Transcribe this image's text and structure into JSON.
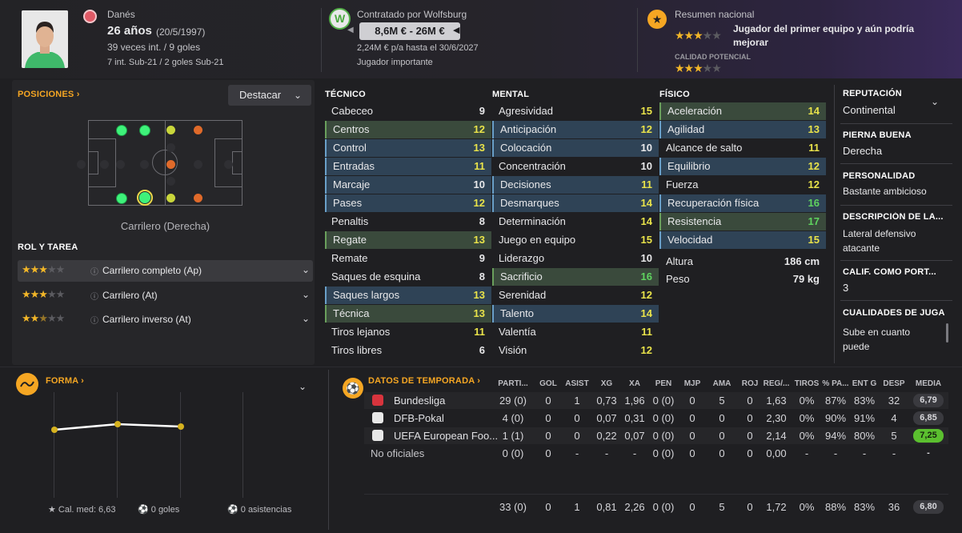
{
  "header": {
    "nationality": "Danés",
    "age": "26 años",
    "birth": "(20/5/1997)",
    "caps": "39 veces int. / 9 goles",
    "youth": "7 int. Sub-21 / 2 goles Sub-21",
    "contract_title": "Contratado por Wolfsburg",
    "value": "8,6M € - 26M €",
    "wage": "2,24M € p/a hasta el 30/6/2027",
    "squad_status": "Jugador importante",
    "national_summary": "Resumen nacional",
    "national_desc": "Jugador del primer equipo y aún podría mejorar",
    "potential_label": "CALIDAD POTENCIAL"
  },
  "positions": {
    "title": "POSICIONES",
    "highlight_btn": "Destacar",
    "selected_role": "Carrilero (Derecha)",
    "role_title": "ROL Y TAREA",
    "roles": [
      {
        "name": "Carrilero completo (Ap)"
      },
      {
        "name": "Carrilero (At)"
      },
      {
        "name": "Carrilero inverso (At)"
      }
    ]
  },
  "attributes": {
    "tech_title": "TÉCNICO",
    "mental_title": "MENTAL",
    "phys_title": "FÍSICO",
    "technical": [
      {
        "n": "Cabeceo",
        "v": "9"
      },
      {
        "n": "Centros",
        "v": "12"
      },
      {
        "n": "Control",
        "v": "13"
      },
      {
        "n": "Entradas",
        "v": "11"
      },
      {
        "n": "Marcaje",
        "v": "10"
      },
      {
        "n": "Pases",
        "v": "12"
      },
      {
        "n": "Penaltis",
        "v": "8"
      },
      {
        "n": "Regate",
        "v": "13"
      },
      {
        "n": "Remate",
        "v": "9"
      },
      {
        "n": "Saques de esquina",
        "v": "8"
      },
      {
        "n": "Saques largos",
        "v": "13"
      },
      {
        "n": "Técnica",
        "v": "13"
      },
      {
        "n": "Tiros lejanos",
        "v": "11"
      },
      {
        "n": "Tiros libres",
        "v": "6"
      }
    ],
    "mental": [
      {
        "n": "Agresividad",
        "v": "15"
      },
      {
        "n": "Anticipación",
        "v": "12"
      },
      {
        "n": "Colocación",
        "v": "10"
      },
      {
        "n": "Concentración",
        "v": "10"
      },
      {
        "n": "Decisiones",
        "v": "11"
      },
      {
        "n": "Desmarques",
        "v": "14"
      },
      {
        "n": "Determinación",
        "v": "14"
      },
      {
        "n": "Juego en equipo",
        "v": "15"
      },
      {
        "n": "Liderazgo",
        "v": "10"
      },
      {
        "n": "Sacrificio",
        "v": "16"
      },
      {
        "n": "Serenidad",
        "v": "12"
      },
      {
        "n": "Talento",
        "v": "14"
      },
      {
        "n": "Valentía",
        "v": "11"
      },
      {
        "n": "Visión",
        "v": "12"
      }
    ],
    "physical": [
      {
        "n": "Aceleración",
        "v": "14"
      },
      {
        "n": "Agilidad",
        "v": "13"
      },
      {
        "n": "Alcance de salto",
        "v": "11"
      },
      {
        "n": "Equilibrio",
        "v": "12"
      },
      {
        "n": "Fuerza",
        "v": "12"
      },
      {
        "n": "Recuperación física",
        "v": "16"
      },
      {
        "n": "Resistencia",
        "v": "17"
      },
      {
        "n": "Velocidad",
        "v": "15"
      }
    ],
    "height_label": "Altura",
    "height": "186 cm",
    "weight_label": "Peso",
    "weight": "79 kg"
  },
  "info": {
    "rep_label": "REPUTACIÓN",
    "rep": "Continental",
    "foot_label": "PIERNA BUENA",
    "foot": "Derecha",
    "pers_label": "PERSONALIDAD",
    "pers": "Bastante ambicioso",
    "desc_label": "DESCRIPCIÓN DE LA...",
    "desc": "Lateral defensivo atacante",
    "gk_label": "CALIF. COMO PORT...",
    "gk": "3",
    "qual_label": "CUALIDADES DE JUGA",
    "qual": "Sube en cuanto puede"
  },
  "form": {
    "title": "FORMA",
    "avg": "Cal. med: 6,63",
    "goals": "0 goles",
    "assists": "0 asistencias"
  },
  "season": {
    "title": "DATOS DE TEMPORADA",
    "headers": [
      "PARTI...",
      "GOL",
      "ASIST",
      "XG",
      "XA",
      "PEN",
      "MJP",
      "AMA",
      "ROJ",
      "REG/...",
      "TIROS",
      "% PA...",
      "ENT G",
      "DESP",
      "MEDIA"
    ],
    "rows": [
      {
        "comp": "Bundesliga",
        "vals": [
          "29 (0)",
          "0",
          "1",
          "0,73",
          "1,96",
          "0 (0)",
          "0",
          "5",
          "0",
          "1,63",
          "0%",
          "87%",
          "83%",
          "32"
        ],
        "media": "6,79"
      },
      {
        "comp": "DFB-Pokal",
        "vals": [
          "4 (0)",
          "0",
          "0",
          "0,07",
          "0,31",
          "0 (0)",
          "0",
          "0",
          "0",
          "2,30",
          "0%",
          "90%",
          "91%",
          "4"
        ],
        "media": "6,85"
      },
      {
        "comp": "UEFA European Foo...",
        "vals": [
          "1 (1)",
          "0",
          "0",
          "0,22",
          "0,07",
          "0 (0)",
          "0",
          "0",
          "0",
          "2,14",
          "0%",
          "94%",
          "80%",
          "5"
        ],
        "media": "7,25"
      },
      {
        "comp": "No oficiales",
        "vals": [
          "0 (0)",
          "0",
          "-",
          "-",
          "-",
          "0 (0)",
          "0",
          "0",
          "0",
          "0,00",
          "-",
          "-",
          "-",
          "-"
        ],
        "media": "-"
      }
    ],
    "total": {
      "vals": [
        "33 (0)",
        "0",
        "1",
        "0,81",
        "2,26",
        "0 (0)",
        "0",
        "5",
        "0",
        "1,72",
        "0%",
        "88%",
        "83%",
        "36"
      ],
      "media": "6,80"
    }
  },
  "colors": {
    "accent": "#f5a623",
    "green": "#5fd35f",
    "yellow": "#e9e34a",
    "highlight_blue": "#2f4356"
  }
}
